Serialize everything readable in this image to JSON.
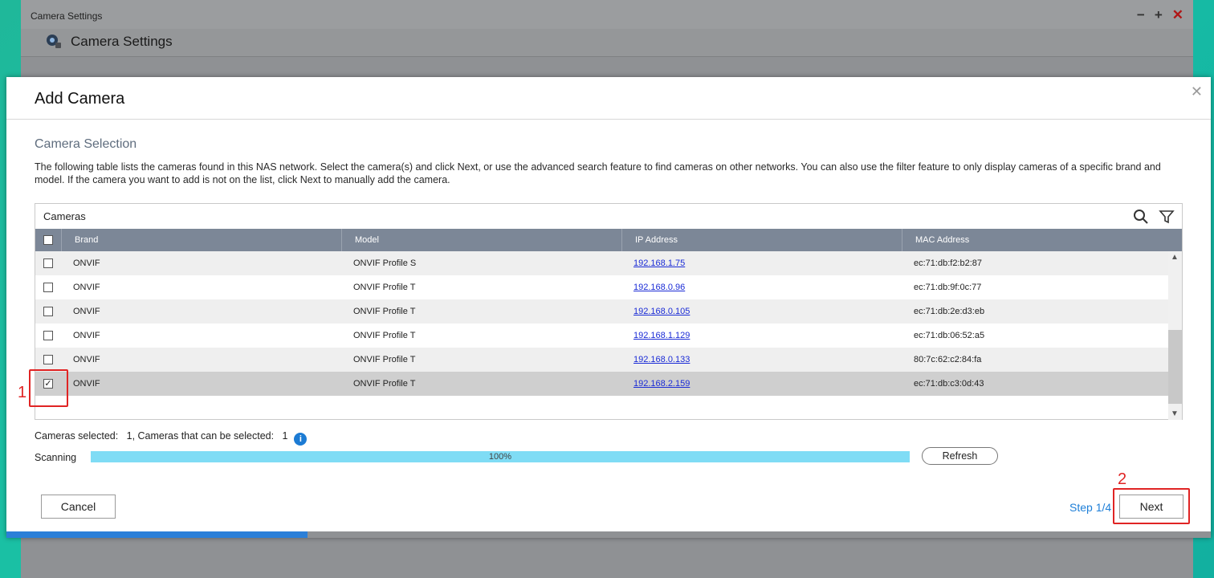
{
  "app": {
    "window_title": "Camera Settings",
    "header_title": "Camera Settings",
    "controls": [
      "−",
      "+",
      "✕"
    ]
  },
  "dialog": {
    "title": "Add Camera",
    "section_title": "Camera Selection",
    "description": "The following table lists the cameras found in this NAS network. Select the camera(s) and click Next, or use the advanced search feature to find cameras on other networks. You can also use the filter feature to only display cameras of a specific brand and model. If the camera you want to add is not on the list, click Next to manually add the camera.",
    "panel_title": "Cameras",
    "columns": [
      "Brand",
      "Model",
      "IP Address",
      "MAC Address"
    ],
    "rows": [
      {
        "brand": "ONVIF",
        "model": "ONVIF Profile S",
        "ip": "192.168.1.75",
        "mac": "ec:71:db:f2:b2:87",
        "checked": false
      },
      {
        "brand": "ONVIF",
        "model": "ONVIF Profile T",
        "ip": "192.168.0.96",
        "mac": "ec:71:db:9f:0c:77",
        "checked": false
      },
      {
        "brand": "ONVIF",
        "model": "ONVIF Profile T",
        "ip": "192.168.0.105",
        "mac": "ec:71:db:2e:d3:eb",
        "checked": false
      },
      {
        "brand": "ONVIF",
        "model": "ONVIF Profile T",
        "ip": "192.168.1.129",
        "mac": "ec:71:db:06:52:a5",
        "checked": false
      },
      {
        "brand": "ONVIF",
        "model": "ONVIF Profile T",
        "ip": "192.168.0.133",
        "mac": "80:7c:62:c2:84:fa",
        "checked": false
      },
      {
        "brand": "ONVIF",
        "model": "ONVIF Profile T",
        "ip": "192.168.2.159",
        "mac": "ec:71:db:c3:0d:43",
        "checked": true
      }
    ],
    "selection_info": "Cameras selected:   1, Cameras that can be selected:   1",
    "scanning_label": "Scanning",
    "scan_progress_text": "100%",
    "scan_progress": 1.0,
    "refresh_label": "Refresh",
    "cancel_label": "Cancel",
    "step_label": "Step 1/4",
    "next_label": "Next",
    "wizard_progress": 0.25
  },
  "annotations": [
    "1",
    "2"
  ],
  "colors": {
    "accent": "#1e7fd8",
    "table_header": "#7c8797",
    "progress_fill": "#7fdcf5",
    "annotation": "#e02424"
  }
}
